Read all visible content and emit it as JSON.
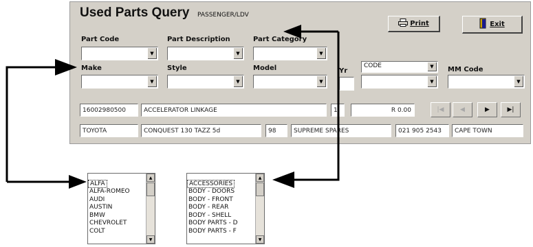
{
  "title": "Used Parts Query",
  "subtitle": "PASSENGER/LDV",
  "buttons": {
    "print": "Print",
    "exit": "Exit"
  },
  "labels": {
    "part_code": "Part Code",
    "part_description": "Part Description",
    "part_category": "Part Category",
    "make": "Make",
    "style": "Style",
    "model": "Model",
    "yr": "Yr",
    "code_combo": "CODE",
    "mm_code": "MM Code"
  },
  "result_row1": {
    "part_code": "16002980500",
    "description": "ACCELERATOR LINKAGE",
    "qty": "1",
    "price": "R 0.00"
  },
  "result_row2": {
    "make": "TOYOTA",
    "model": "CONQUEST 130 TAZZ 5d",
    "year": "98",
    "supplier": "SUPREME SPARES",
    "phone": "021 905 2543",
    "city": "CAPE TOWN"
  },
  "nav": {
    "first": "|◀",
    "prev": "◀",
    "next": "▶",
    "last": "▶|"
  },
  "make_list": [
    "ALFA",
    "ALFA-ROMEO",
    "AUDI",
    "AUSTIN",
    "BMW",
    "CHEVROLET",
    "COLT"
  ],
  "category_list": [
    "ACCESSORIES",
    "BODY - DOORS",
    "BODY - FRONT",
    "BODY - REAR",
    "BODY - SHELL",
    "BODY PARTS - D",
    "BODY PARTS - F"
  ],
  "icons": {
    "print": "printer-icon",
    "exit": "door-exit-icon",
    "dropdown": "dropdown-arrow-icon"
  }
}
